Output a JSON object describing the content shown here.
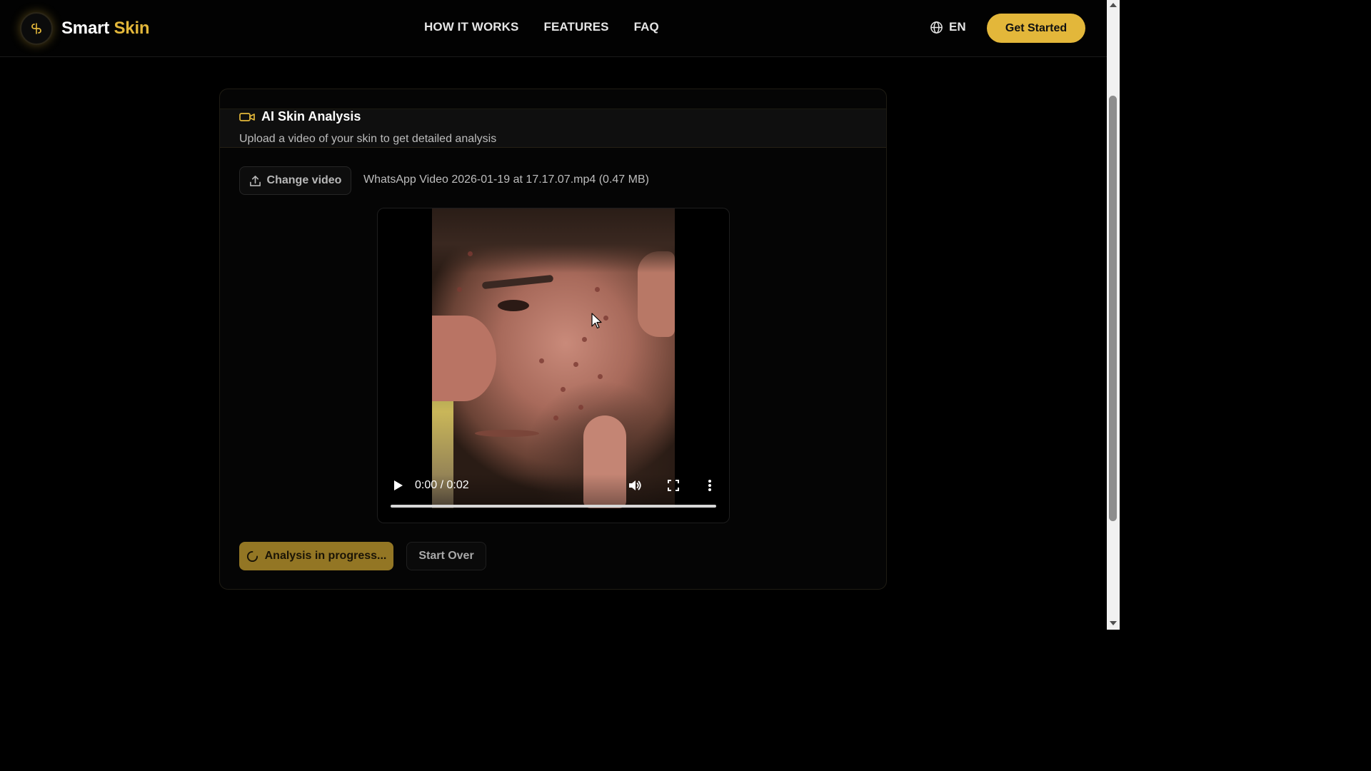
{
  "header": {
    "logo_word1": "Smart",
    "logo_word2": "Skin",
    "nav": [
      "HOW IT WORKS",
      "FEATURES",
      "FAQ"
    ],
    "language": "EN",
    "cta_label": "Get Started"
  },
  "card": {
    "title": "AI Skin Analysis",
    "subtitle": "Upload a video of your skin to get detailed analysis",
    "change_video_label": "Change video",
    "file_info": "WhatsApp Video 2026-01-19 at 17.17.07.mp4 (0.47 MB)",
    "video": {
      "time": "0:00 / 0:02",
      "progress": 0
    },
    "analyze_label": "Analysis in progress...",
    "start_over_label": "Start Over"
  },
  "colors": {
    "accent": "#e3b73a",
    "accent_dim": "#937624",
    "background": "#000000"
  },
  "icons": {
    "logo": "logo-icon",
    "language": "globe-icon",
    "title": "video-camera-icon",
    "upload": "upload-icon",
    "spinner": "spinner-icon",
    "play": "play-icon",
    "volume": "volume-icon",
    "fullscreen": "fullscreen-icon",
    "more": "more-vertical-icon"
  }
}
